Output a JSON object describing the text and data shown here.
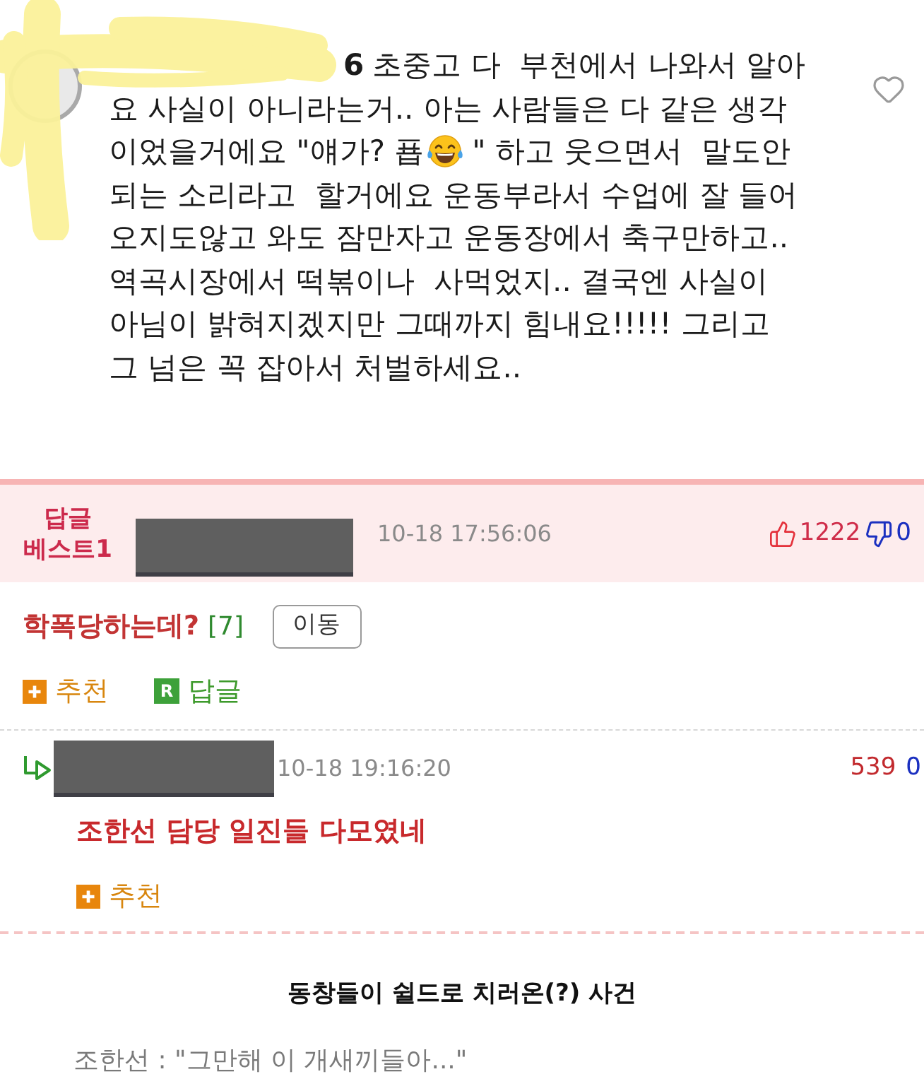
{
  "comment": {
    "username": "6",
    "liked": false,
    "lines": [
      [
        {
          "kind": "text",
          "text": "초중고 다  부천에서 나와서 알아"
        }
      ],
      [
        {
          "kind": "text",
          "text": "요 사실이 아니라는거.. 아는 사람들은 다 같은 생각"
        }
      ],
      [
        {
          "kind": "text",
          "text": "이었을거에요 \"얘가? 푭"
        },
        {
          "kind": "emoji"
        },
        {
          "kind": "text",
          "text": "\" 하고 웃으면서  말도안"
        }
      ],
      [
        {
          "kind": "text",
          "text": "되는 소리라고  할거에요 운동부라서 수업에 잘 들어"
        }
      ],
      [
        {
          "kind": "text",
          "text": "오지도않고 와도 잠만자고 운동장에서 축구만하고.."
        }
      ],
      [
        {
          "kind": "text",
          "text": "역곡시장에서 떡볶이나  사먹었지.. 결국엔 사실이"
        }
      ],
      [
        {
          "kind": "text",
          "text": "아님이 밝혀지겠지만 그때까지 힘내요!!!!! 그리고"
        }
      ],
      [
        {
          "kind": "text",
          "text": "그 넘은 꼭 잡아서 처벌하세요.."
        }
      ]
    ]
  },
  "best_reply": {
    "label": "답글 베스트1",
    "timestamp": "10-18 17:56:06",
    "upvotes": "1222",
    "downvotes": "0",
    "title": "학폭당하는데?",
    "reply_count": "[7]",
    "move_button": "이동",
    "actions": [
      {
        "kind": "recommend",
        "label": "추천"
      },
      {
        "kind": "reply",
        "badge": "R",
        "label": "답글"
      }
    ]
  },
  "reply": {
    "timestamp": "10-18 19:16:20",
    "upvotes": "539",
    "downvotes": "0",
    "text": "조한선 담당 일진들 다모였네",
    "actions": [
      {
        "kind": "recommend",
        "label": "추천"
      }
    ]
  },
  "article": {
    "heading": "동창들이 쉴드로 치러온(?) 사건",
    "quote": "조한선 : \"그만해 이 개새끼들아...\""
  }
}
